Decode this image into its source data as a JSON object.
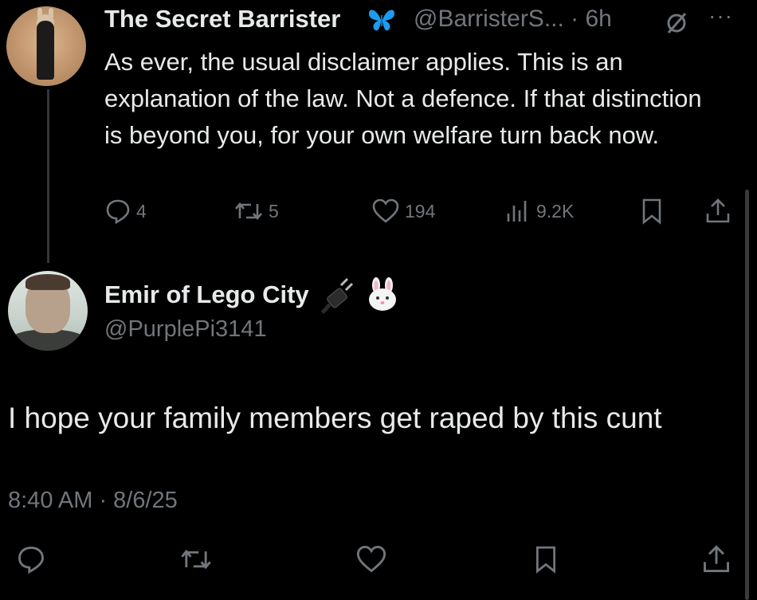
{
  "parent_tweet": {
    "author_name": "The Secret Barrister",
    "handle_time": "@BarristerS... · 6h",
    "more_label": "···",
    "text": "As ever, the usual disclaimer applies. This is an explanation of the law. Not a defence. If that distinction is beyond you, for your own welfare turn back now.",
    "replies": "4",
    "reposts": "5",
    "likes": "194",
    "views": "9.2K"
  },
  "main_tweet": {
    "author_name": "Emir of Lego City",
    "handle": "@PurplePi3141",
    "text": "I hope your family members get raped by this cunt",
    "timestamp": "8:40 AM · 8/6/25"
  },
  "icons": {
    "verified": "butterfly-verified-icon",
    "reply": "reply-icon",
    "repost": "repost-icon",
    "like": "heart-icon",
    "views": "views-icon",
    "bookmark": "bookmark-icon",
    "share": "share-icon",
    "grok": "grok-icon"
  },
  "colors": {
    "background": "#000000",
    "text": "#e7e9ea",
    "muted": "#71767b",
    "verified_blue": "#1d9bf0"
  }
}
